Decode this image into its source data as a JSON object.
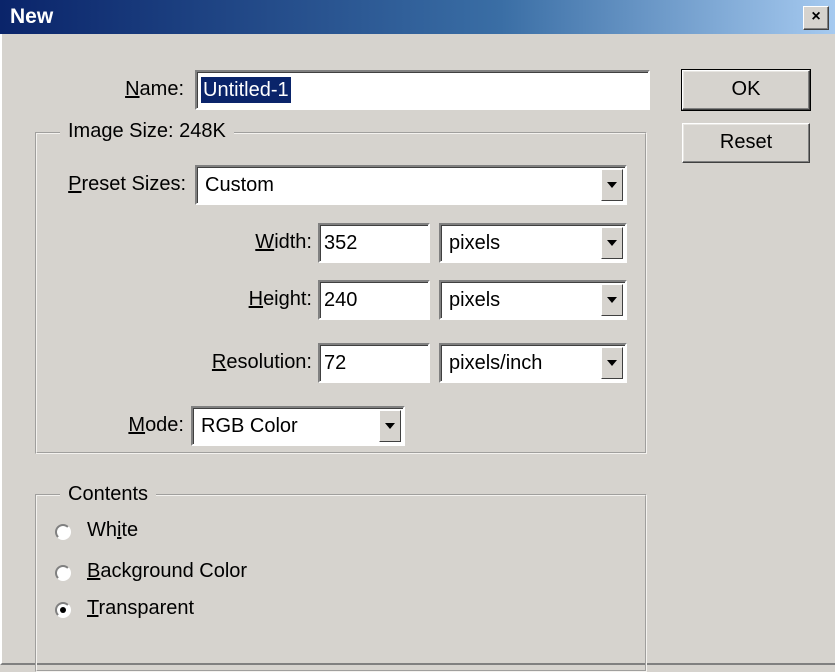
{
  "window": {
    "title": "New",
    "close_label": "×"
  },
  "name": {
    "label_u": "N",
    "label_rest": "ame:",
    "value": "Untitled-1"
  },
  "buttons": {
    "ok": "OK",
    "reset": "Reset"
  },
  "image_size": {
    "legend": "Image Size: 248K",
    "preset": {
      "label_u": "P",
      "label_rest": "reset Sizes:",
      "value": "Custom"
    },
    "width": {
      "label_pre": "",
      "label_u": "W",
      "label_rest": "idth:",
      "value": "352",
      "unit": "pixels"
    },
    "height": {
      "label_pre": "",
      "label_u": "H",
      "label_rest": "eight:",
      "value": "240",
      "unit": "pixels"
    },
    "resolution": {
      "label_pre": "",
      "label_u": "R",
      "label_rest": "esolution:",
      "value": "72",
      "unit": "pixels/inch"
    },
    "mode": {
      "label_u": "M",
      "label_rest": "ode:",
      "value": "RGB Color"
    }
  },
  "contents": {
    "legend": "Contents",
    "options": [
      {
        "pre": "Wh",
        "u": "i",
        "rest": "te",
        "checked": false
      },
      {
        "pre": "",
        "u": "B",
        "rest": "ackground Color",
        "checked": false
      },
      {
        "pre": "",
        "u": "T",
        "rest": "ransparent",
        "checked": true
      }
    ]
  }
}
